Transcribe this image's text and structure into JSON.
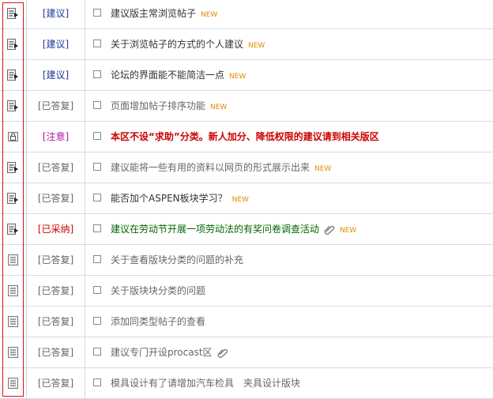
{
  "rows": [
    {
      "tag": "[建议]",
      "tag_color": "blue",
      "icon": "new-reply-icon",
      "title": "建议版主常浏览帖子",
      "title_style": "",
      "new": "NEW",
      "clip": false
    },
    {
      "tag": "[建议]",
      "tag_color": "blue",
      "icon": "new-reply-icon",
      "title": "关于浏览帖子的方式的个人建议",
      "title_style": "",
      "new": "NEW",
      "clip": false
    },
    {
      "tag": "[建议]",
      "tag_color": "blue",
      "icon": "new-reply-icon",
      "title": "论坛的界面能不能简洁一点",
      "title_style": "",
      "new": "NEW",
      "clip": false
    },
    {
      "tag": "[已答复]",
      "tag_color": "gray",
      "icon": "new-reply-icon",
      "title": "页面增加帖子排序功能",
      "title_style": "read",
      "new": "NEW",
      "clip": false
    },
    {
      "tag": "[注意]",
      "tag_color": "purple",
      "icon": "lock-icon",
      "title": "本区不设“求助”分类。新人加分、降低权限的建议请到相关版区",
      "title_style": "sticky",
      "new": "",
      "clip": false
    },
    {
      "tag": "[已答复]",
      "tag_color": "gray",
      "icon": "new-reply-icon",
      "title": "建议能将一些有用的资料以网页的形式展示出来",
      "title_style": "read",
      "new": "NEW",
      "clip": false
    },
    {
      "tag": "[已答复]",
      "tag_color": "gray",
      "icon": "new-reply-icon",
      "title": "能否加个ASPEN板块学习？",
      "title_style": "",
      "new": "NEW",
      "clip": false
    },
    {
      "tag": "[已采纳]",
      "tag_color": "red",
      "icon": "new-reply-icon",
      "title": "建议在劳动节开展一项劳动法的有奖问卷调查活动",
      "title_style": "green",
      "new": "NEW",
      "clip": true
    },
    {
      "tag": "[已答复]",
      "tag_color": "gray",
      "icon": "topic-icon",
      "title": "关于查看版块分类的问题的补充",
      "title_style": "read",
      "new": "",
      "clip": false
    },
    {
      "tag": "[已答复]",
      "tag_color": "gray",
      "icon": "topic-icon",
      "title": "关于版块块分类的问题",
      "title_style": "read",
      "new": "",
      "clip": false
    },
    {
      "tag": "[已答复]",
      "tag_color": "gray",
      "icon": "topic-icon",
      "title": "添加同类型帖子的查看",
      "title_style": "read",
      "new": "",
      "clip": false
    },
    {
      "tag": "[已答复]",
      "tag_color": "gray",
      "icon": "topic-icon",
      "title": "建议专门开设procast区",
      "title_style": "read",
      "new": "",
      "clip": true
    },
    {
      "tag": "[已答复]",
      "tag_color": "gray",
      "icon": "topic-icon",
      "title": "模具设计有了请增加汽车检具　夹具设计版块",
      "title_style": "read",
      "new": "",
      "clip": false
    }
  ]
}
